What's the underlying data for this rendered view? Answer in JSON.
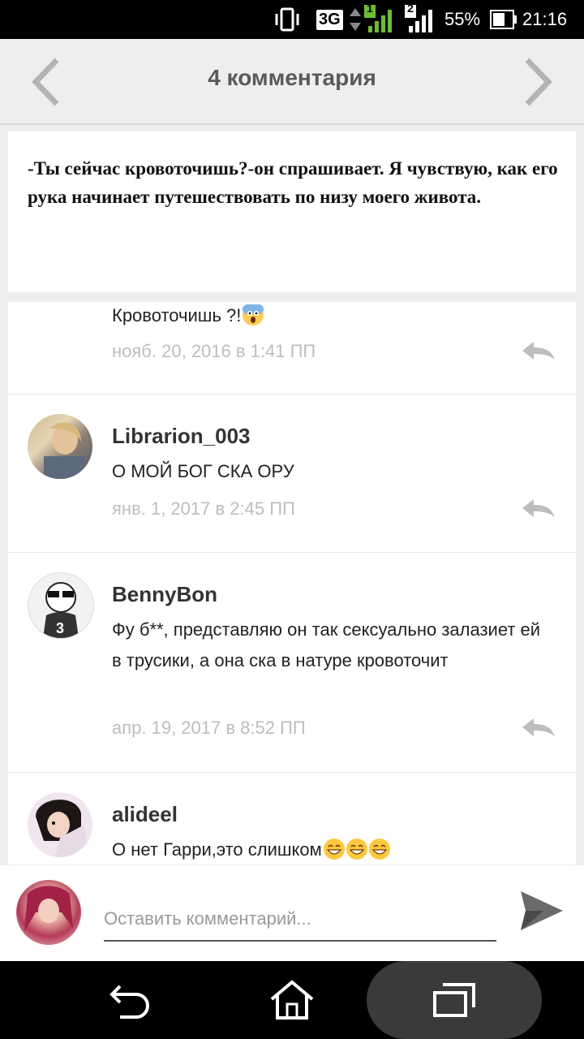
{
  "status_bar": {
    "network": "3G",
    "sim1": "1",
    "sim2": "2",
    "battery": "55%",
    "time": "21:16",
    "icons": [
      "vibrate-icon",
      "network-3g-icon",
      "data-arrows-icon",
      "signal-sim1-icon",
      "signal-sim2-icon",
      "battery-icon"
    ]
  },
  "header": {
    "title": "4 комментария",
    "prev_icon": "chevron-left-icon",
    "next_icon": "chevron-right-icon"
  },
  "excerpt": {
    "text": "-Ты сейчас кровоточишь?-он спрашивает. Я чувствую, как его рука начинает путешествовать по низу моего живота."
  },
  "comments": [
    {
      "name": "",
      "text": "Кровоточишь ?!",
      "emoji": "scream-emoji",
      "time": "нояб. 20, 2016 в 1:41 ПП"
    },
    {
      "name": "Librarion_003",
      "text": "О МОЙ БОГ СКА ОРУ",
      "time": "янв. 1, 2017 в 2:45 ПП"
    },
    {
      "name": "BennyBon",
      "text": "Фу б**, представляю он так сексуально залазиет ей в трусики, а она ска в натуре кровоточит",
      "time": "апр. 19, 2017 в 8:52 ПП"
    },
    {
      "name": "alideel",
      "text": "О нет Гарри,это слишком",
      "emoji": "grinning-emoji",
      "time": ""
    }
  ],
  "input": {
    "placeholder": "Оставить комментарий...",
    "send_icon": "send-icon"
  },
  "nav": {
    "icons": [
      "back-icon",
      "home-icon",
      "recents-icon"
    ]
  },
  "colors": {
    "header_bg": "#eeeeee",
    "title": "#5a5a5a",
    "timestamp": "#bdbdbd",
    "signal_green": "#6ebe2f"
  }
}
